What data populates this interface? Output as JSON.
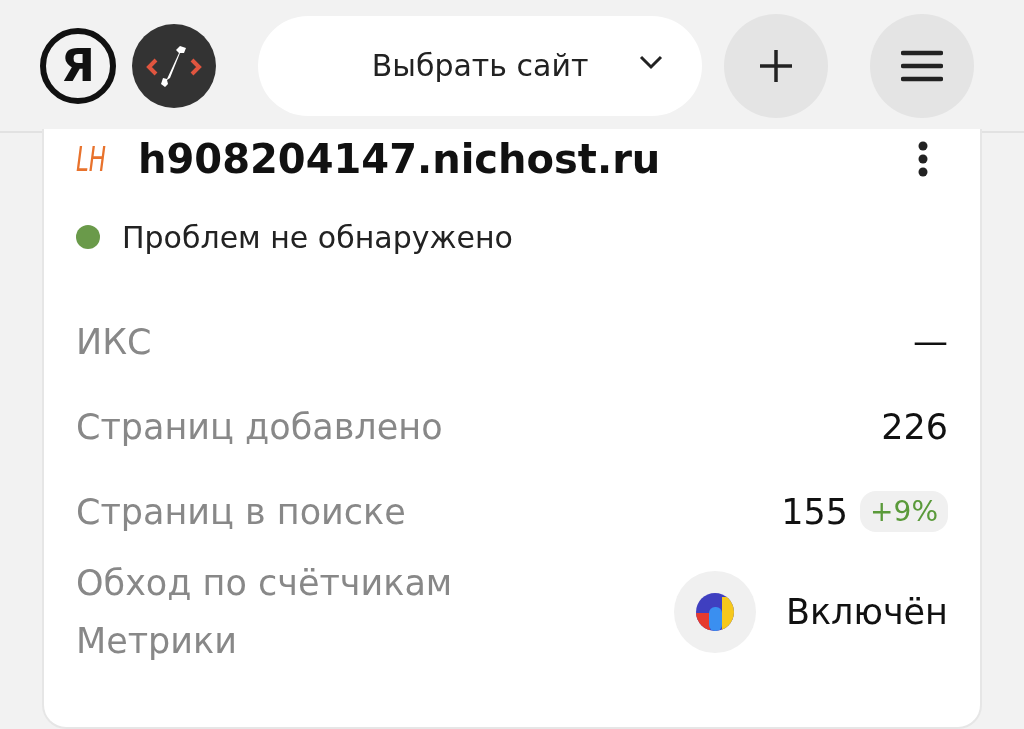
{
  "header": {
    "logo_letter": "Я",
    "site_select": {
      "label": "Выбрать сайт"
    }
  },
  "site": {
    "favicon_text": "LH",
    "name": "h908204147.nichost.ru",
    "status": {
      "text": "Проблем не обнаружено",
      "color": "#6a9a4a"
    }
  },
  "rows": [
    {
      "kind": "value",
      "label": "ИКС",
      "value": "—"
    },
    {
      "kind": "value",
      "label": "Страниц добавлено",
      "value": "226"
    },
    {
      "kind": "badge",
      "label": "Страниц в поиске",
      "value": "155",
      "badge": "+9%"
    },
    {
      "kind": "metrika",
      "label": "Обход по счётчикам Метрики",
      "value": "Включён"
    }
  ]
}
